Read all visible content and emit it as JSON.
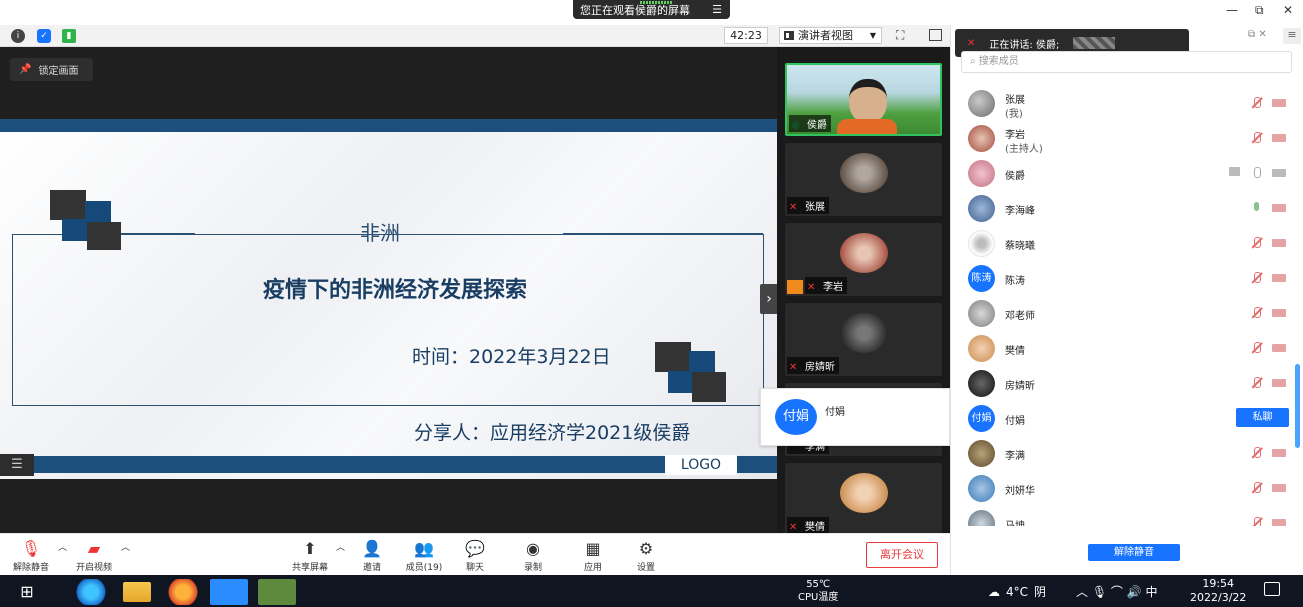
{
  "share_banner": {
    "text": "您正在观看侯爵的屏幕"
  },
  "window_controls": {
    "minimize": "—",
    "restore": "⧉",
    "close": "✕"
  },
  "top_toolbar": {
    "timer": "42:23",
    "view_label": "演讲者视图",
    "icons": [
      "info-icon",
      "shield-icon",
      "signal-icon",
      "fullscreen-icon",
      "panel-toggle-icon"
    ]
  },
  "share_area": {
    "lock_label": "锁定画面",
    "slide": {
      "heading": "非洲",
      "title": "疫情下的非洲经济发展探索",
      "date": "时间：2022年3月22日",
      "presenter": "分享人：应用经济学2021级侯爵",
      "logo": "LOGO"
    }
  },
  "video_strip": {
    "tiles": [
      {
        "name": "侯爵",
        "active": true
      },
      {
        "name": "张展"
      },
      {
        "name": "李岩"
      },
      {
        "name": "房婧昕"
      },
      {
        "name": "李满"
      },
      {
        "name": "樊倩"
      }
    ]
  },
  "hover_card": {
    "avatar_text": "付娟",
    "name": "付娟"
  },
  "right_panel": {
    "speaking_label": "正在讲话: 侯爵;",
    "search_placeholder": "搜索成员",
    "members": [
      {
        "name": "张展",
        "sub": "(我)",
        "mic": "muted",
        "cam": "off"
      },
      {
        "name": "李岩",
        "sub": "(主持人)",
        "mic": "muted",
        "cam": "off"
      },
      {
        "name": "侯爵",
        "mic": "gray",
        "cam": "gray",
        "sharing": true
      },
      {
        "name": "李海峰",
        "mic": "on",
        "cam": "off"
      },
      {
        "name": "蔡晓曦",
        "mic": "muted",
        "cam": "off"
      },
      {
        "name": "陈涛",
        "avatar_text": "陈涛",
        "mic": "muted",
        "cam": "off"
      },
      {
        "name": "邓老师",
        "mic": "muted",
        "cam": "off"
      },
      {
        "name": "樊倩",
        "mic": "muted",
        "cam": "off"
      },
      {
        "name": "房婧昕",
        "mic": "muted",
        "cam": "off"
      },
      {
        "name": "付娟",
        "avatar_text": "付娟",
        "action": "私聊"
      },
      {
        "name": "李满",
        "mic": "muted",
        "cam": "off"
      },
      {
        "name": "刘妍华",
        "mic": "muted",
        "cam": "off"
      },
      {
        "name": "马坤",
        "mic": "muted",
        "cam": "off"
      }
    ],
    "private_chat_label": "私聊",
    "unmute_all_label": "解除静音"
  },
  "bottom_toolbar": {
    "unmute": "解除静音",
    "start_video": "开启视频",
    "share_screen": "共享屏幕",
    "invite": "邀请",
    "members": "成员(19)",
    "chat": "聊天",
    "record": "录制",
    "apps": "应用",
    "settings": "设置",
    "leave": "离开会议"
  },
  "taskbar": {
    "cpu_temp": "55℃",
    "cpu_label": "CPU温度",
    "weather_temp": "4°C",
    "weather_desc": "阴",
    "ime": "中",
    "time": "19:54",
    "date": "2022/3/22"
  }
}
